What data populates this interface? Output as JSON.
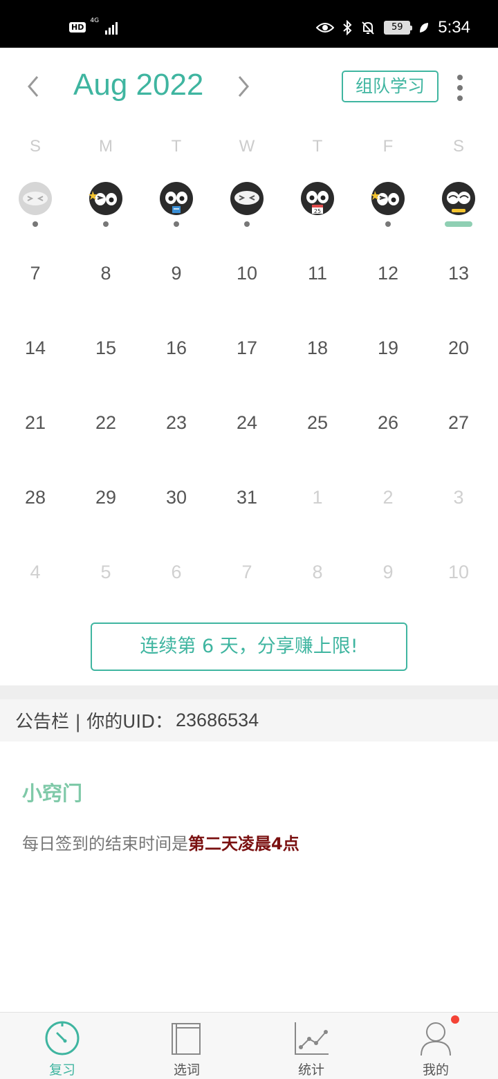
{
  "status_bar": {
    "hd": "HD",
    "network": "4G",
    "battery": "59",
    "time": "5:34"
  },
  "header": {
    "month_title": "Aug 2022",
    "team_button": "组队学习"
  },
  "weekdays": [
    "S",
    "M",
    "T",
    "W",
    "T",
    "F",
    "S"
  ],
  "avatars": [
    "sleeping-face-icon",
    "winking-face-icon",
    "studying-face-icon",
    "sleeping-face-icon",
    "calendar-face-icon",
    "winking-face-icon",
    "smiling-face-icon"
  ],
  "dates": [
    [
      "7",
      "8",
      "9",
      "10",
      "11",
      "12",
      "13"
    ],
    [
      "14",
      "15",
      "16",
      "17",
      "18",
      "19",
      "20"
    ],
    [
      "21",
      "22",
      "23",
      "24",
      "25",
      "26",
      "27"
    ],
    [
      "28",
      "29",
      "30",
      "31",
      "1",
      "2",
      "3"
    ],
    [
      "4",
      "5",
      "6",
      "7",
      "8",
      "9",
      "10"
    ]
  ],
  "calendar_badge": "25",
  "share_button": "连续第 6 天，分享赚上限!",
  "notice": {
    "label": "公告栏 | 你的UID：",
    "uid": "23686534"
  },
  "tip": {
    "title": "小窍门",
    "text": "每日签到的结束时间是",
    "highlight": "第二天凌晨4点"
  },
  "tabs": [
    {
      "label": "复习",
      "icon": "review-gauge-icon"
    },
    {
      "label": "选词",
      "icon": "book-icon"
    },
    {
      "label": "统计",
      "icon": "chart-icon"
    },
    {
      "label": "我的",
      "icon": "user-icon"
    }
  ],
  "colors": {
    "accent": "#3fb5a0",
    "highlight": "#7a1010",
    "badge": "#f44336"
  }
}
